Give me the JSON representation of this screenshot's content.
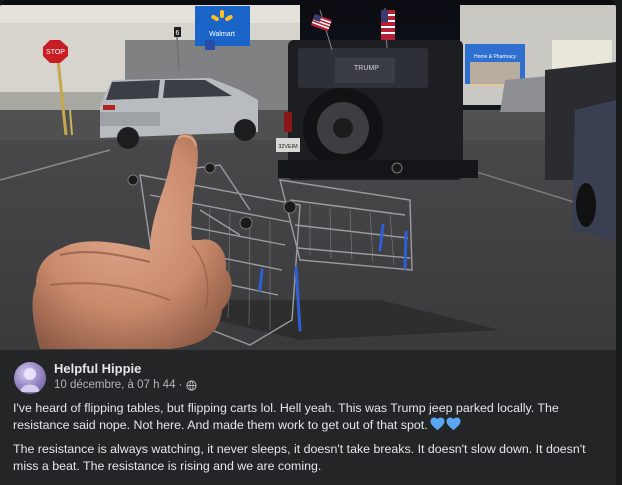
{
  "photo": {
    "store_sign": "Walmart",
    "stop_sign": "STOP",
    "spare_cover_text": "TRUMP",
    "license_plate": "32VEIM",
    "pharmacy_sign": "Home & Pharmacy",
    "lot_number": "6"
  },
  "post": {
    "author": "Helpful Hippie",
    "date": "10 décembre, à 07 h 44",
    "separator": "·",
    "privacy_icon": "globe-icon",
    "paragraph1": "I've heard of flipping tables, but flipping carts lol.  Hell yeah. This was Trump jeep parked locally. The resistance said nope. Not here.  And made them work to get out of that spot.",
    "paragraph1_emoji": "blue-heart-icon",
    "paragraph2": "The resistance is always watching, it never sleeps, it doesn't take breaks. It doesn't slow down. It doesn't miss a beat. The resistance is rising and we are coming."
  },
  "colors": {
    "card_bg": "#242526",
    "page_bg": "#18191a",
    "primary_text": "#e4e6eb",
    "secondary_text": "#b0b3b8",
    "heart_blue": "#5aa8f5"
  }
}
